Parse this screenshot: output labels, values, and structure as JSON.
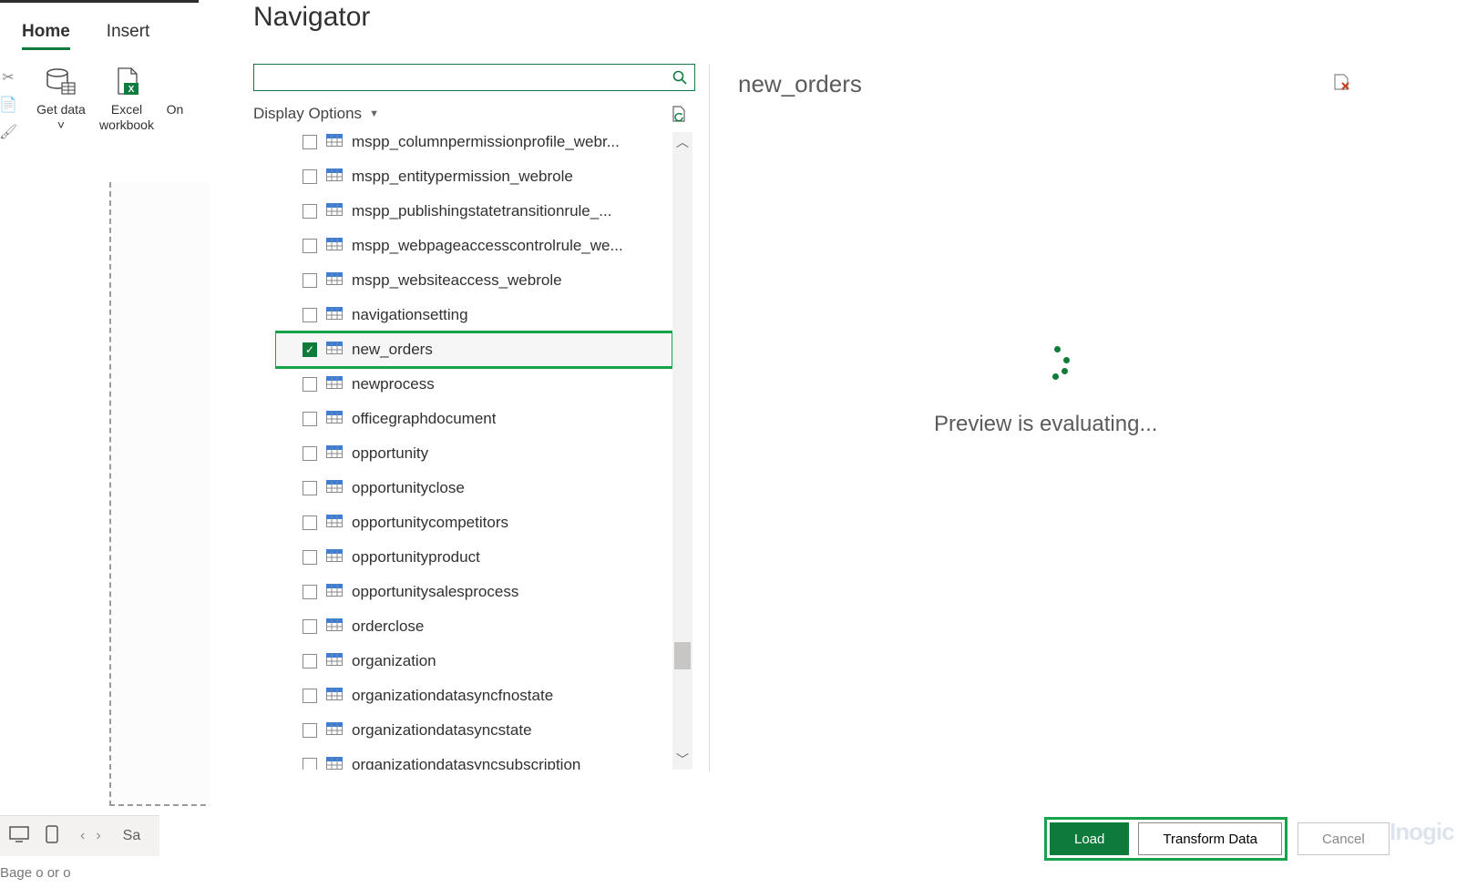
{
  "ribbon": {
    "tabs": {
      "home": "Home",
      "insert": "Insert"
    },
    "buttons": {
      "get_data": "Get data",
      "get_data_suffix": "˅",
      "excel": "Excel workbook",
      "other": "On"
    }
  },
  "bottom": {
    "sa": "Sa",
    "page_info": "Bage o or o"
  },
  "navigator": {
    "title": "Navigator",
    "display_options": "Display Options",
    "search_placeholder": ""
  },
  "tree": {
    "items": [
      {
        "label": "mspp_columnpermissionprofile_webr...",
        "checked": false
      },
      {
        "label": "mspp_entitypermission_webrole",
        "checked": false
      },
      {
        "label": "mspp_publishingstatetransitionrule_...",
        "checked": false
      },
      {
        "label": "mspp_webpageaccesscontrolrule_we...",
        "checked": false
      },
      {
        "label": "mspp_websiteaccess_webrole",
        "checked": false
      },
      {
        "label": "navigationsetting",
        "checked": false
      },
      {
        "label": "new_orders",
        "checked": true,
        "selected": true
      },
      {
        "label": "newprocess",
        "checked": false
      },
      {
        "label": "officegraphdocument",
        "checked": false
      },
      {
        "label": "opportunity",
        "checked": false
      },
      {
        "label": "opportunityclose",
        "checked": false
      },
      {
        "label": "opportunitycompetitors",
        "checked": false
      },
      {
        "label": "opportunityproduct",
        "checked": false
      },
      {
        "label": "opportunitysalesprocess",
        "checked": false
      },
      {
        "label": "orderclose",
        "checked": false
      },
      {
        "label": "organization",
        "checked": false
      },
      {
        "label": "organizationdatasyncfnostate",
        "checked": false
      },
      {
        "label": "organizationdatasyncstate",
        "checked": false
      },
      {
        "label": "organizationdatasyncsubscription",
        "checked": false
      }
    ]
  },
  "preview": {
    "title": "new_orders",
    "message": "Preview is evaluating..."
  },
  "buttons": {
    "load": "Load",
    "transform": "Transform Data",
    "cancel": "Cancel"
  },
  "watermark": "Inogic"
}
